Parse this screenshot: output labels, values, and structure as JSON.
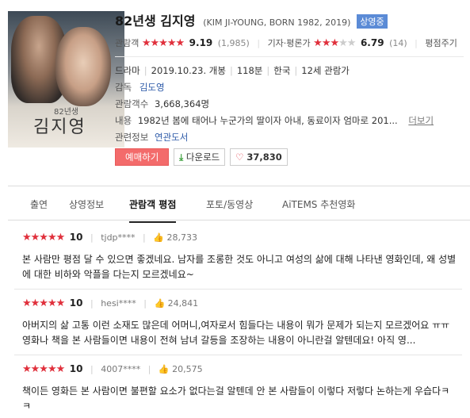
{
  "movie": {
    "title_ko": "82년생 김지영",
    "title_en": "(KIM JI-YOUNG, BORN 1982, 2019)",
    "badge": "상영중",
    "poster_title_small": "82년생",
    "poster_title": "김지영"
  },
  "ratings": {
    "audience_label": "관람객",
    "audience_score": "9.19",
    "audience_count": "(1,985)",
    "audience_stars": 4.6,
    "critic_label": "기자·평론가",
    "critic_score": "6.79",
    "critic_count": "(14)",
    "critic_stars": 3.4,
    "netizen_label": "평점주기"
  },
  "meta": {
    "genre": "드라마",
    "release": "2019.10.23. 개봉",
    "runtime": "118분",
    "country": "한국",
    "grade": "12세 관람가",
    "director_label": "감독",
    "director": "김도영",
    "audience_label": "관람객수",
    "audience": "3,668,364명",
    "plot_label": "내용",
    "plot": "1982년 봄에 태어나 누군가의 딸이자 아내, 동료이자 엄마로 201...",
    "more_label": "더보기",
    "related_label": "관련정보",
    "related": "연관도서"
  },
  "buttons": {
    "book": "예매하기",
    "download": "다운로드",
    "likes": "37,830"
  },
  "tabs": [
    "출연",
    "상영정보",
    "관람객 평점",
    "포토/동영상",
    "AiTEMS 추천영화"
  ],
  "active_tab": 2,
  "reviews": [
    {
      "score": "10",
      "stars": 5,
      "user": "tjdp****",
      "likes": "28,733",
      "text": "본 사람만 평점 달 수 있으면 좋겠네요. 남자를 조롱한 것도 아니고 여성의 삶에 대해 나타낸 영화인데, 왜 성별에 대한 비하와 악플을 다는지 모르겠네요~"
    },
    {
      "score": "10",
      "stars": 5,
      "user": "hesi****",
      "likes": "24,841",
      "text": "아버지의 삶 고통 이런 소재도 많은데 어머니,여자로서 힘들다는 내용이 뭐가 문제가 되는지 모르겠어요 ㅠㅠ 영화나 책을 본 사람들이면 내용이 전혀 남녀 갈등을 조장하는 내용이 아니란걸 알텐데요! 아직 영..."
    },
    {
      "score": "10",
      "stars": 5,
      "user": "4007****",
      "likes": "20,575",
      "text": "책이든 영화든 본 사람이면 불편할 요소가 없다는걸 알텐데 안 본 사람들이 이렇다 저렇다 논하는게 우습다ㅋㅋ"
    }
  ],
  "colors": {
    "star": "#e0303c",
    "badge": "#5b8bd6",
    "book_button": "#f36b6b",
    "link": "#2d5aa8"
  }
}
